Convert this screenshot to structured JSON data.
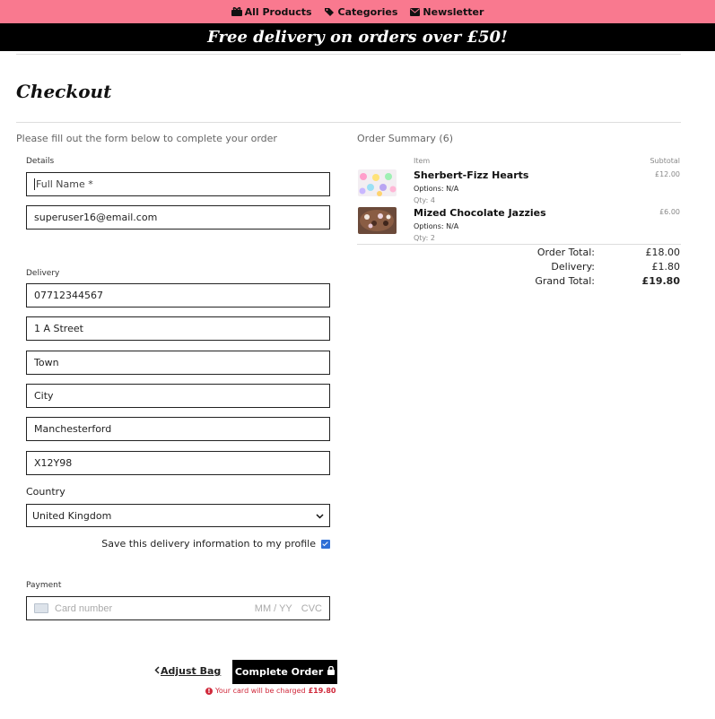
{
  "nav": {
    "items": [
      {
        "label": "All Products",
        "icon": "gifts-icon"
      },
      {
        "label": "Categories",
        "icon": "tags-icon"
      },
      {
        "label": "Newsletter",
        "icon": "envelope-icon"
      }
    ]
  },
  "promo": {
    "text": "Free delivery on orders over £50!"
  },
  "page": {
    "title": "Checkout"
  },
  "form": {
    "intro": "Please fill out the form below to complete your order",
    "details_label": "Details",
    "full_name_placeholder": "Full Name *",
    "email_value": "superuser16@email.com",
    "delivery_label": "Delivery",
    "phone_value": "07712344567",
    "street_value": "1 A Street",
    "town_value": "Town",
    "city_value": "City",
    "county_value": "Manchesterford",
    "postcode_value": "X12Y98",
    "country_label": "Country",
    "country_value": "United Kingdom",
    "save_label": "Save this delivery information to my profile",
    "save_checked": true,
    "payment_label": "Payment",
    "card_placeholder": "Card number",
    "card_exp_placeholder": "MM / YY",
    "card_cvc_placeholder": "CVC"
  },
  "actions": {
    "adjust_bag": "Adjust Bag",
    "complete_order": "Complete Order",
    "charge_note_prefix": "Your card will be charged",
    "charge_amount": "£19.80"
  },
  "summary": {
    "title": "Order Summary (6)",
    "col_item": "Item",
    "col_subtotal": "Subtotal",
    "items": [
      {
        "name": "Sherbert-Fizz Hearts",
        "options": "Options: N/A",
        "qty": "Qty: 4",
        "subtotal": "£12.00"
      },
      {
        "name": "Mized Chocolate Jazzies",
        "options": "Options: N/A",
        "qty": "Qty: 2",
        "subtotal": "£6.00"
      }
    ],
    "order_total_label": "Order Total:",
    "order_total": "£18.00",
    "delivery_label": "Delivery:",
    "delivery": "£1.80",
    "grand_total_label": "Grand Total:",
    "grand_total": "£19.80"
  },
  "colors": {
    "nav_bg": "#f9798f",
    "promo_bg": "#000000",
    "accent_error": "#d0293b"
  }
}
